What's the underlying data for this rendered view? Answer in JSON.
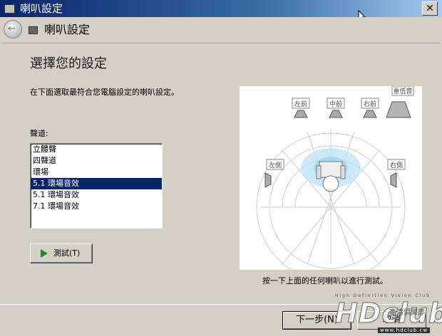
{
  "window": {
    "title": "喇叭設定",
    "close_glyph": "✕"
  },
  "nav": {
    "title": "喇叭設定",
    "back_glyph": "←"
  },
  "page": {
    "heading": "選擇您的設定",
    "description": "在下面選取最符合您電腦設定的喇叭設定。",
    "channel_label": "聲道:",
    "channels": [
      "立體聲",
      "四聲道",
      "環場",
      "5.1 環場音效",
      "5.1 環場音效",
      "7.1 環場音效"
    ],
    "selected_channel_index": 3,
    "test_button": "測試(T)",
    "hint": "按一下上面的任何喇叭以進行測試。"
  },
  "speakers": {
    "front_left": "左前",
    "center": "中前",
    "front_right": "右前",
    "subwoofer": "重低音",
    "side_left": "左側",
    "side_right": "右側"
  },
  "buttons": {
    "next": "下一步(N)",
    "cancel": "取消"
  },
  "watermark": {
    "brand": "HDclub",
    "tagline": "High Definition Vision Club",
    "cn": "高清俱樂部",
    "url": "www.hdclub.cw"
  },
  "colors": {
    "title_start": "#0a246a",
    "title_end": "#a6caf0",
    "selection": "#0a246a",
    "sweet_spot": "#bfe3f7",
    "play": "#1f8f1f"
  }
}
